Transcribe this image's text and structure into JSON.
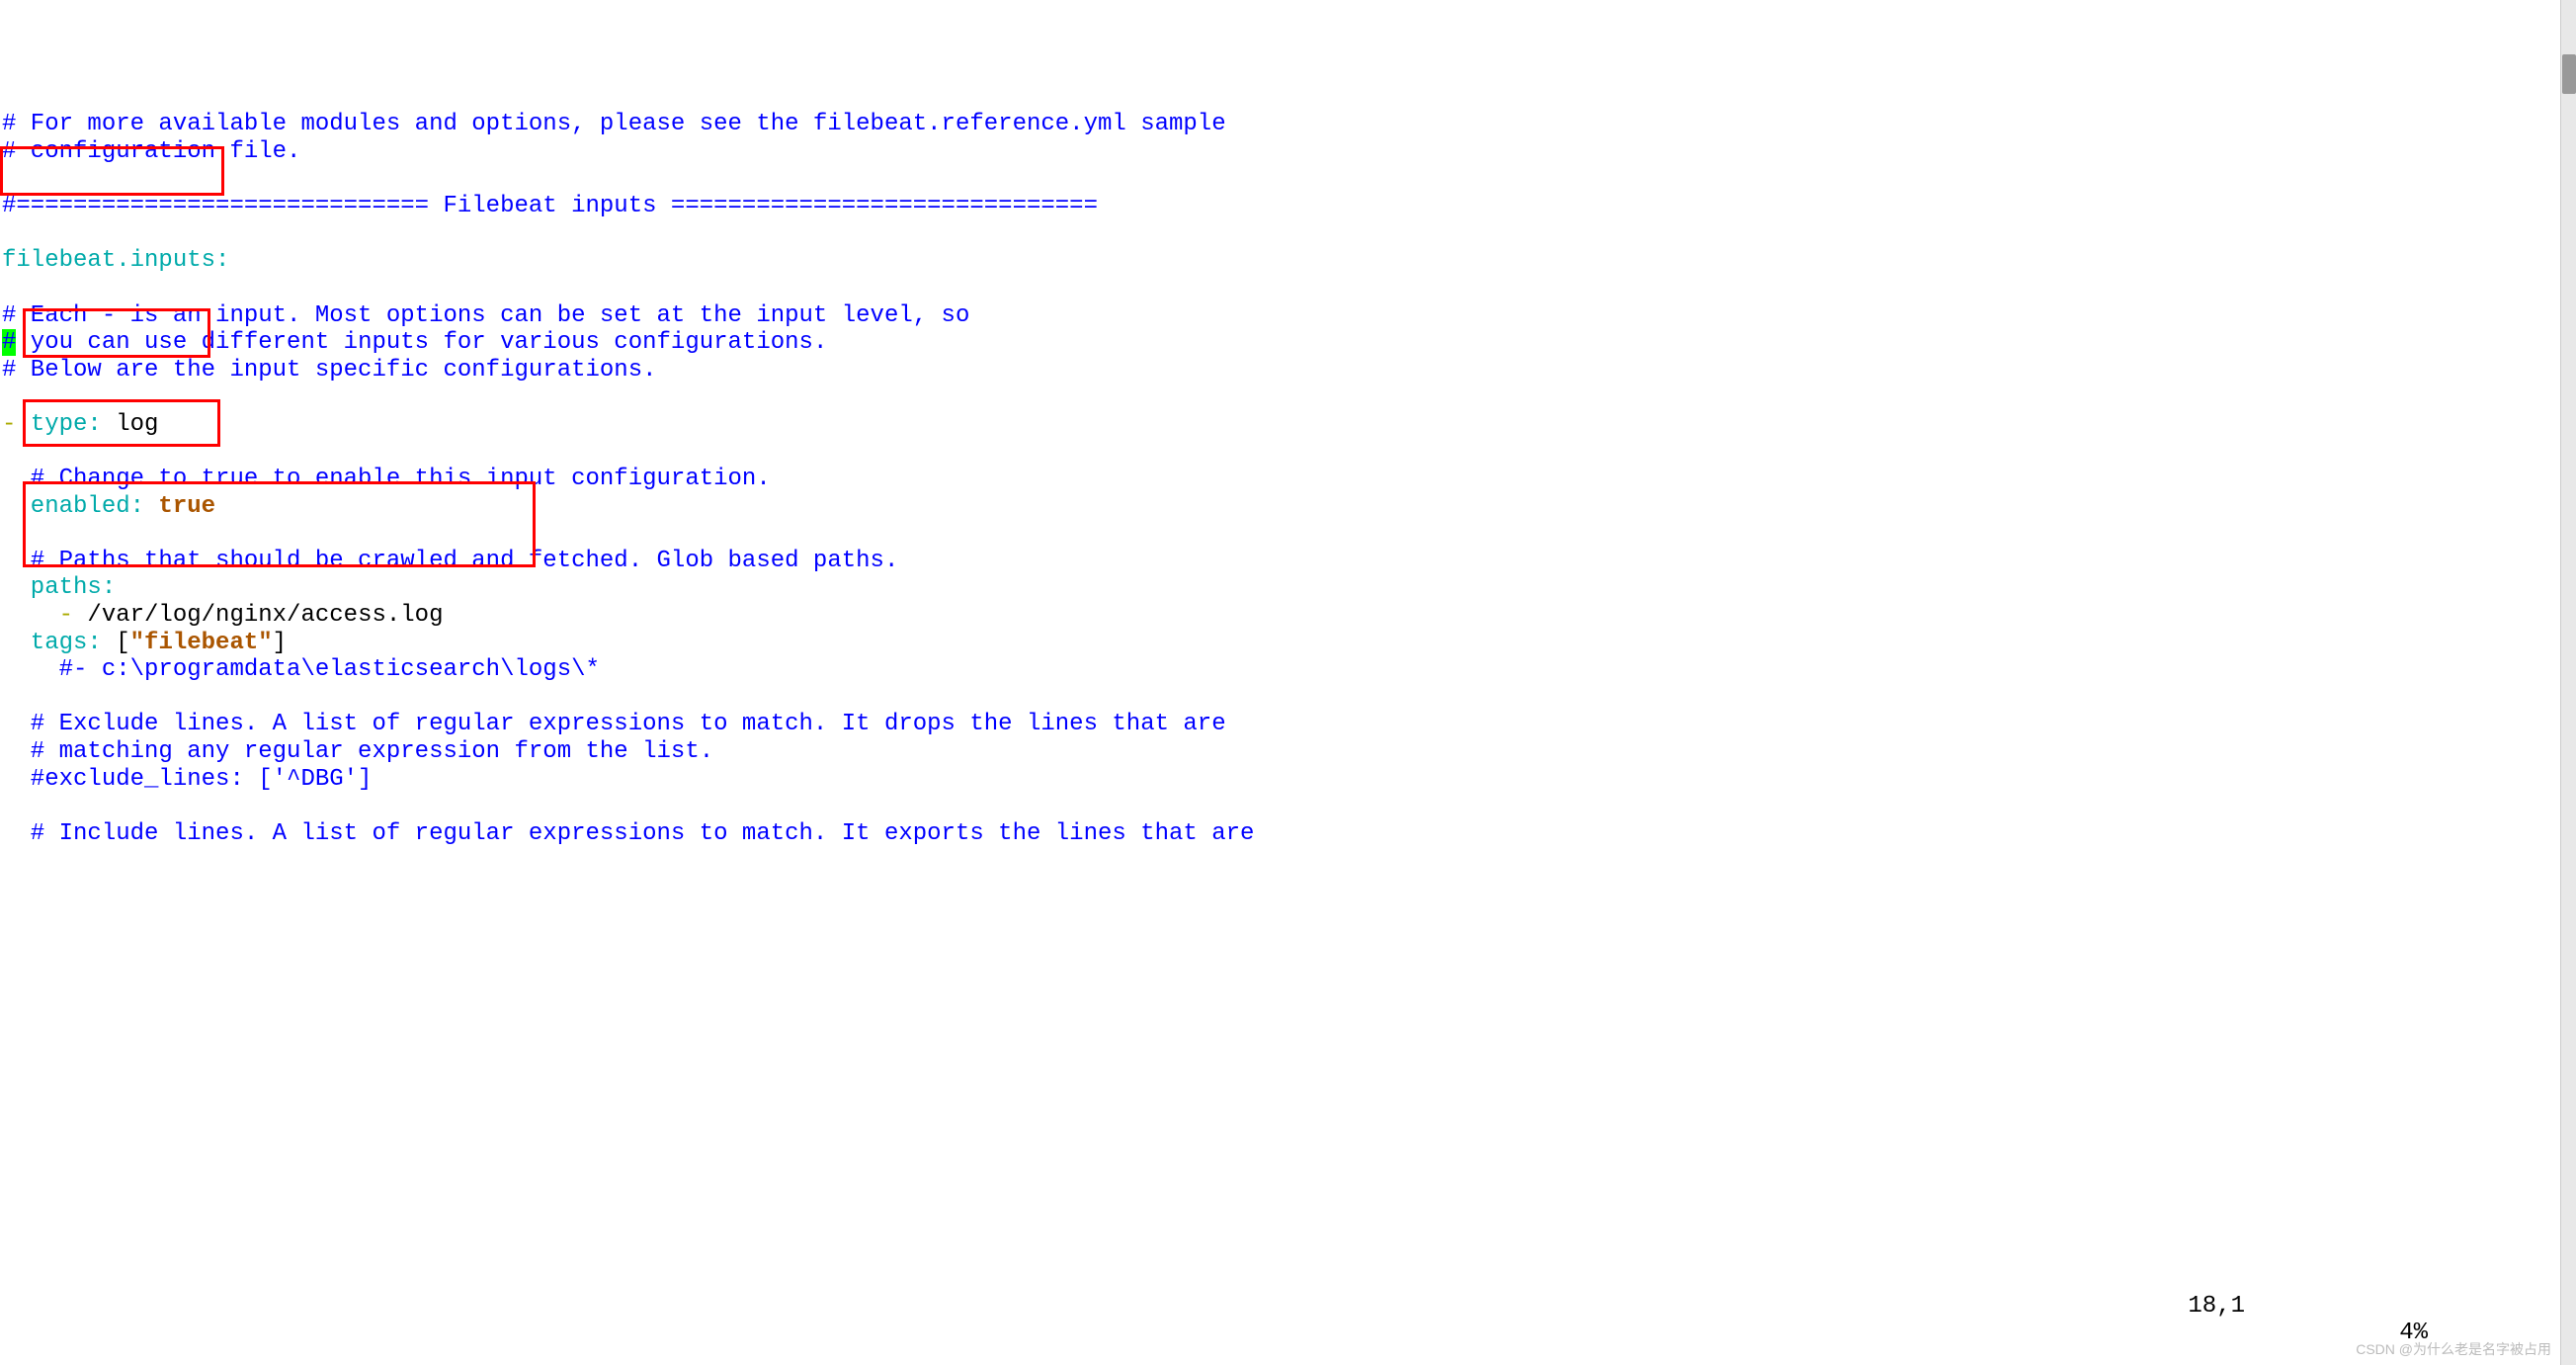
{
  "lines": {
    "c1": "# For more available modules and options, please see the filebeat.reference.yml sample",
    "c2": "# configuration file.",
    "blank1": "",
    "c3": "#============================= Filebeat inputs ==============================",
    "blank2": "",
    "k1": "filebeat.inputs:",
    "blank3": "",
    "c4": "# Each - is an input. Most options can be set at the input level, so",
    "c5a": "#",
    "c5b": " you can use different inputs for various configurations.",
    "c6": "# Below are the input specific configurations.",
    "blank4": "",
    "dash1": "- ",
    "k2": "type:",
    "v2": " log",
    "blank5": "",
    "c7": "  # Change to true to enable this input configuration.",
    "k3": "  enabled:",
    "v3": " true",
    "blank6": "",
    "c8": "  # Paths that should be crawled and fetched. Glob based paths.",
    "k4": "  paths:",
    "dash2": "    - ",
    "p1": "/var/log/nginx/access.log",
    "k5": "  tags:",
    "v5a": " [",
    "v5b": "\"filebeat\"",
    "v5c": "]",
    "c9": "    #- c:\\programdata\\elasticsearch\\logs\\*",
    "blank7": "",
    "c10": "  # Exclude lines. A list of regular expressions to match. It drops the lines that are",
    "c11": "  # matching any regular expression from the list.",
    "c12": "  #exclude_lines: ['^DBG']",
    "blank8": "",
    "c13": "  # Include lines. A list of regular expressions to match. It exports the lines that are"
  },
  "status": {
    "line_col": "18,1",
    "percent": "4%"
  },
  "watermark": "CSDN @为什么老是名字被占用"
}
